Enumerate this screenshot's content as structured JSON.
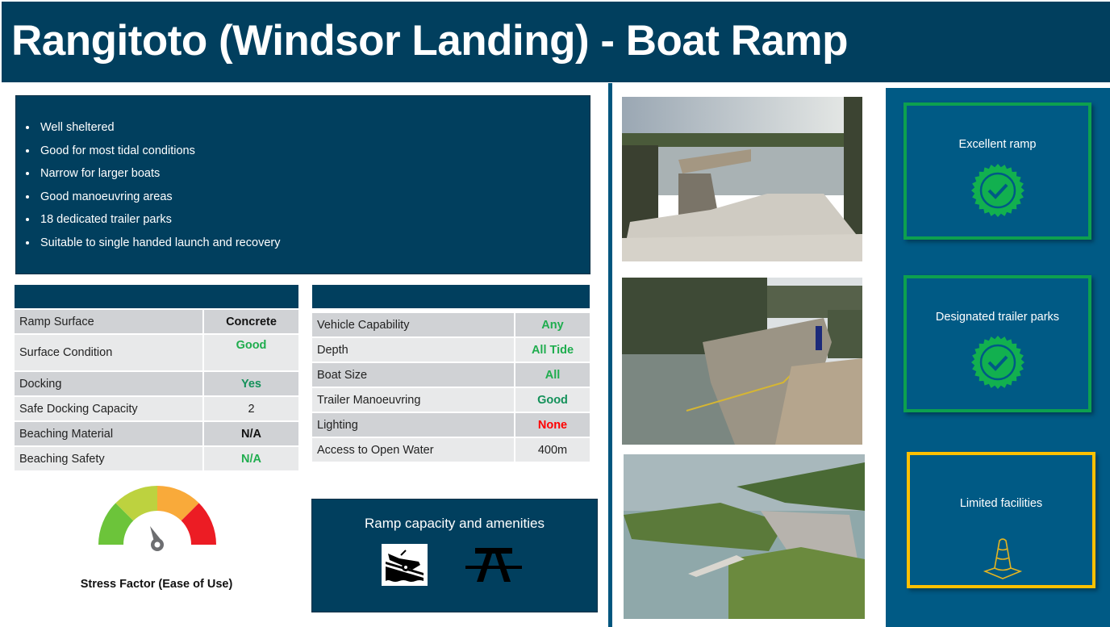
{
  "header": {
    "title": "Rangitoto (Windsor Landing) - Boat Ramp"
  },
  "highlights": [
    "Well sheltered",
    "Good for most tidal conditions",
    "Narrow for larger boats",
    "Good manoeuvring  areas",
    "18 dedicated trailer parks",
    "Suitable to single handed launch and recovery"
  ],
  "ramp_table": {
    "rows": [
      {
        "label": "Ramp Surface",
        "value": "Concrete",
        "color": "#111111"
      },
      {
        "label": "Surface Condition",
        "value": "Good",
        "color": "#1fad4e"
      },
      {
        "label": "Docking",
        "value": "Yes",
        "color": "#14915a"
      },
      {
        "label": "Safe Docking Capacity",
        "value": "2",
        "color": "#222222"
      },
      {
        "label": "Beaching Material",
        "value": "N/A",
        "color": "#111111"
      },
      {
        "label": "Beaching Safety",
        "value": "N/A",
        "color": "#1fad4e"
      }
    ]
  },
  "access_table": {
    "rows": [
      {
        "label": "Vehicle Capability",
        "value": "Any",
        "color": "#1fad4e"
      },
      {
        "label": "Depth",
        "value": "All Tide",
        "color": "#1fad4e"
      },
      {
        "label": "Boat Size",
        "value": "All",
        "color": "#1fad4e"
      },
      {
        "label": "Trailer Manoeuvring",
        "value": "Good",
        "color": "#14915a"
      },
      {
        "label": "Lighting",
        "value": "None",
        "color": "#ff0000"
      },
      {
        "label": "Access to Open Water",
        "value": "400m",
        "color": "#222222"
      }
    ]
  },
  "stress_gauge": {
    "label": "Stress Factor (Ease of Use)",
    "segments": [
      "#6cc43a",
      "#bdd23f",
      "#f9aa3a",
      "#ec1c24"
    ],
    "needle_level": 0.4
  },
  "amenities": {
    "heading": "Ramp capacity and amenities",
    "icons": [
      "boat-ramp-icon",
      "picnic-table-icon"
    ]
  },
  "photos": [
    {
      "alt": "Concrete boat ramp with wooden jetty at dusk"
    },
    {
      "alt": "Ramp entering water beside wooden wharf"
    },
    {
      "alt": "Aerial view of ramp, carpark and moored boats"
    }
  ],
  "badges": [
    {
      "label": "Excellent ramp",
      "icon": "verified-badge-icon",
      "color": "#0da04f"
    },
    {
      "label": "Designated trailer parks",
      "icon": "verified-badge-icon",
      "color": "#0da04f"
    },
    {
      "label": "Limited facilities",
      "icon": "traffic-cone-icon",
      "color": "#ffc000"
    }
  ],
  "colors": {
    "navy": "#013f5e",
    "panel_blue": "#005a85",
    "row_dark": "#d0d2d5",
    "row_light": "#e8e9ea"
  }
}
